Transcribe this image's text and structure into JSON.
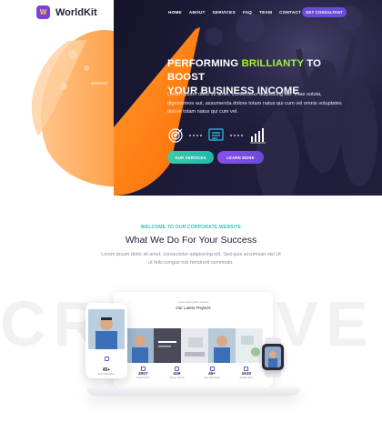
{
  "brand": {
    "name": "WorldKit",
    "mark": "W"
  },
  "nav": {
    "items": [
      "HOME",
      "ABOUT",
      "SERVICES",
      "FAQ",
      "TEAM",
      "CONTACT"
    ],
    "cta": "GET CONSALTANT"
  },
  "hero": {
    "title_line1_pre": "PERFORMING ",
    "title_highlight": "BRILLIANTY",
    "title_line1_post": " TO BOOST",
    "title_line2": "YOUR BUSINESS INCOME",
    "description": "Lorem ipsum dolor sit amet, consectetur adipisicing elit. Vitae soluta, dignissimos aut, assumenda dolore totam natus qui cum vel omnis voluptates dolore totam natus qui cum vel.",
    "btn_services": "OUR SERVICES",
    "btn_learn": "LEARN MORE",
    "icons": [
      "target-icon",
      "monitor-icon",
      "bar-chart-icon"
    ]
  },
  "section": {
    "tag": "WELCOME TO OUR CORPORATE WEBSITE",
    "title": "What We Do For Your Success",
    "description": "Lorem ipsum dolor sit amet, consectetur adipisicing elit. Sed quis accumsan nisi Ut ut felis congue nisl hendrerit commodo.",
    "watermark": "CREATIVE E"
  },
  "mockup": {
    "laptop": {
      "kicker": "Lorem ipsum dolor sit amet",
      "title": "Our Latest Projects",
      "stats": [
        {
          "num": "2007",
          "label": "Project Done"
        },
        {
          "num": "426",
          "label": "Happy Clients"
        },
        {
          "num": "45+",
          "label": "Team Members"
        },
        {
          "num": "1510",
          "label": "Awards Won"
        }
      ]
    },
    "phone": {
      "num": "45+",
      "label": "Team Members"
    }
  },
  "colors": {
    "accent_purple": "#6a4bd8",
    "accent_green": "#a6ee3a",
    "accent_orange": "#ff7b16",
    "hero_dark": "#1d1c3a"
  }
}
